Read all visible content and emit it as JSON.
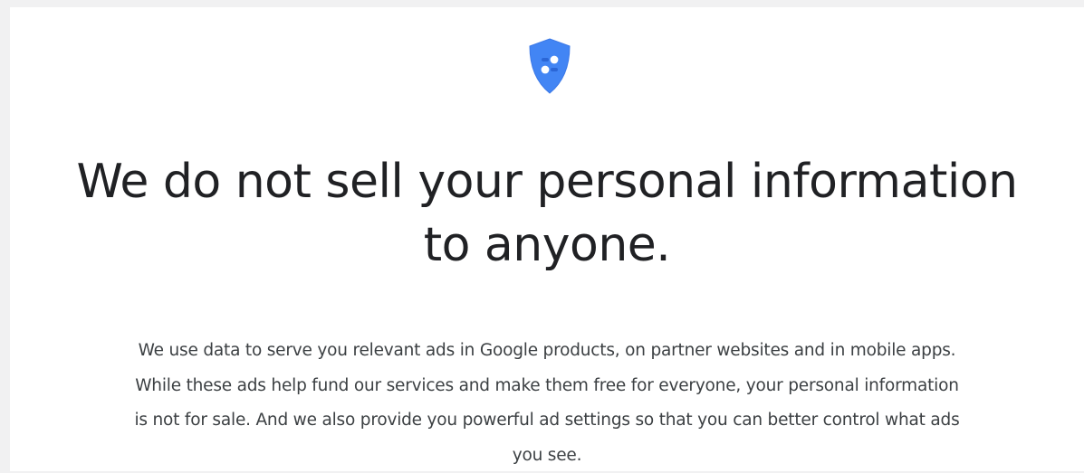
{
  "page": {
    "icon": "privacy-shield-icon",
    "headline_line1": "We do not sell your personal information",
    "headline_line2": "to anyone.",
    "body_lines": [
      "We use data to serve you relevant ads in Google products, on partner websites and in mobile apps.",
      "While these ads help fund our services and make them free for everyone, your personal information",
      "is not for sale. And we also provide you powerful ad settings so that you can better control what ads",
      "you see."
    ]
  },
  "colors": {
    "shield": "#4285f4",
    "shield_detail": "#ffffff",
    "headline": "#202124",
    "body": "#3c4043",
    "background": "#ffffff",
    "outer_background": "#f1f1f2"
  }
}
